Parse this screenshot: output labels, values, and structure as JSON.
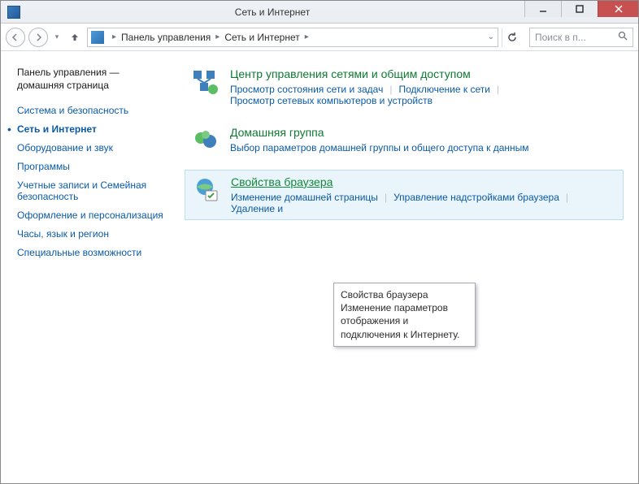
{
  "titlebar": {
    "title": "Сеть и Интернет"
  },
  "breadcrumb": {
    "root": "Панель управления",
    "current": "Сеть и Интернет"
  },
  "search": {
    "placeholder": "Поиск в п..."
  },
  "sidebar": {
    "home_line1": "Панель управления —",
    "home_line2": "домашняя страница",
    "items": [
      {
        "label": "Система и безопасность",
        "active": false
      },
      {
        "label": "Сеть и Интернет",
        "active": true
      },
      {
        "label": "Оборудование и звук",
        "active": false
      },
      {
        "label": "Программы",
        "active": false
      },
      {
        "label": "Учетные записи и Семейная безопасность",
        "active": false
      },
      {
        "label": "Оформление и персонализация",
        "active": false
      },
      {
        "label": "Часы, язык и регион",
        "active": false
      },
      {
        "label": "Специальные возможности",
        "active": false
      }
    ]
  },
  "sections": {
    "network": {
      "title": "Центр управления сетями и общим доступом",
      "links": {
        "l1": "Просмотр состояния сети и задач",
        "l2": "Подключение к сети",
        "l3": "Просмотр сетевых компьютеров и устройств"
      }
    },
    "homegroup": {
      "title": "Домашняя группа",
      "links": {
        "l1": "Выбор параметров домашней группы и общего доступа к данным"
      }
    },
    "browser": {
      "title": "Свойства браузера",
      "links": {
        "l1": "Изменение домашней страницы",
        "l2": "Управление надстройками браузера",
        "l3": "Удаление и"
      }
    }
  },
  "tooltip": {
    "title": "Свойства браузера",
    "body": "Изменение параметров отображения и подключения к Интернету."
  }
}
